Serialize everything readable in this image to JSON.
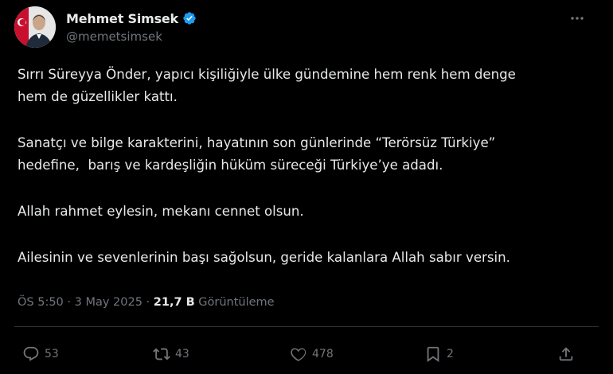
{
  "author": {
    "display_name": "Mehmet Simsek",
    "handle": "@memetsimsek",
    "verified_icon": "verified-badge-icon"
  },
  "tweet": {
    "paragraphs": [
      "Sırrı Süreyya Önder, yapıcı kişiliğiyle ülke gündemine hem renk hem denge\nhem de güzellikler kattı.",
      "Sanatçı ve bilge karakterini, hayatının son günlerinde “Terörsüz Türkiye”\nhedefine,  barış ve kardeşliğin hüküm süreceği Türkiye’ye adadı.",
      "Allah rahmet eylesin, mekanı cennet olsun.",
      "Ailesinin ve sevenlerinin başı sağolsun, geride kalanlara Allah sabır versin."
    ],
    "time": "ÖS 5:50",
    "date": "3 May 2025",
    "separator": " · ",
    "views_count": "21,7 B",
    "views_label": "Görüntüleme"
  },
  "actions": {
    "replies": "53",
    "reposts": "43",
    "likes": "478",
    "bookmarks": "2"
  },
  "colors": {
    "background": "#000000",
    "text": "#e7e9ea",
    "secondary": "#71767b",
    "verified": "#1d9bf0",
    "divider": "#2f3336"
  },
  "icons": {
    "more": "more-icon",
    "reply": "reply-icon",
    "repost": "repost-icon",
    "like": "like-icon",
    "bookmark": "bookmark-icon",
    "share": "share-icon"
  }
}
